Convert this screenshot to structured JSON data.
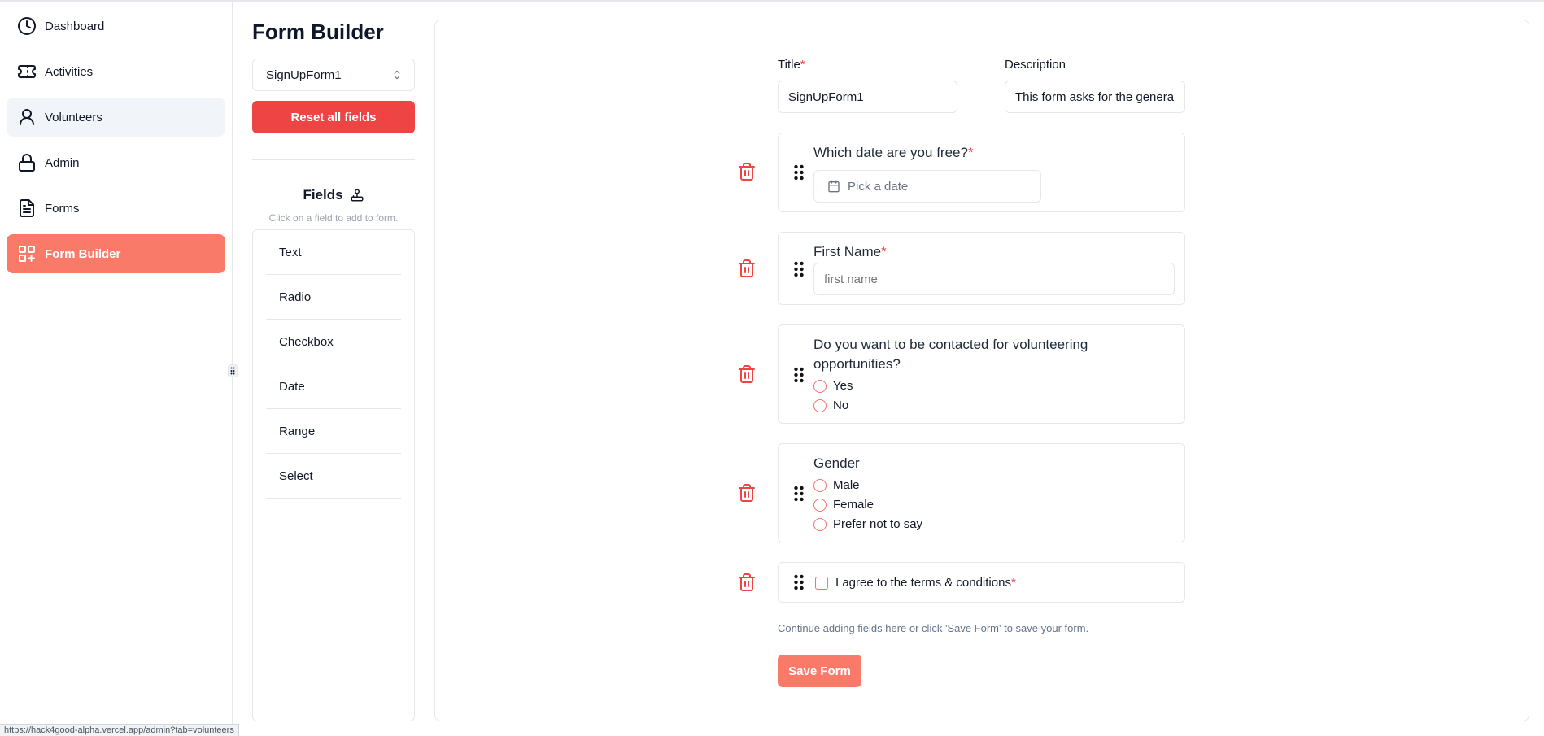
{
  "sidebar": {
    "items": [
      {
        "label": "Dashboard",
        "icon": "clock-icon"
      },
      {
        "label": "Activities",
        "icon": "ticket-icon"
      },
      {
        "label": "Volunteers",
        "icon": "user-icon"
      },
      {
        "label": "Admin",
        "icon": "lock-icon"
      },
      {
        "label": "Forms",
        "icon": "file-text-icon"
      },
      {
        "label": "Form Builder",
        "icon": "layout-blocks-icon"
      }
    ]
  },
  "builder": {
    "title": "Form Builder",
    "form_select": "SignUpForm1",
    "reset_label": "Reset all fields",
    "fields_title": "Fields",
    "fields_hint": "Click on a field to add to form.",
    "field_types": [
      "Text",
      "Radio",
      "Checkbox",
      "Date",
      "Range",
      "Select"
    ]
  },
  "form": {
    "title_label": "Title",
    "title_value": "SignUpForm1",
    "description_label": "Description",
    "description_value": "This form asks for the general information",
    "required_mark": "*",
    "questions": {
      "date": {
        "label": "Which date are you free?",
        "placeholder": "Pick a date"
      },
      "name": {
        "label": "First Name",
        "placeholder": "first name"
      },
      "contact": {
        "label_line1": "Do you want to be contacted for volunteering",
        "label_line2": "opportunities?",
        "options": [
          "Yes",
          "No"
        ]
      },
      "gender": {
        "label": "Gender",
        "options": [
          "Male",
          "Female",
          "Prefer not to say"
        ]
      },
      "terms": {
        "label": "I agree to the terms & conditions"
      }
    },
    "helper_text": "Continue adding fields here or click 'Save Form' to save your form.",
    "save_label": "Save Form"
  },
  "status_url": "https://hack4good-alpha.vercel.app/admin?tab=volunteers",
  "colors": {
    "accent": "#fa7a6a",
    "danger": "#ef4444",
    "hover": "#f1f5f9"
  }
}
